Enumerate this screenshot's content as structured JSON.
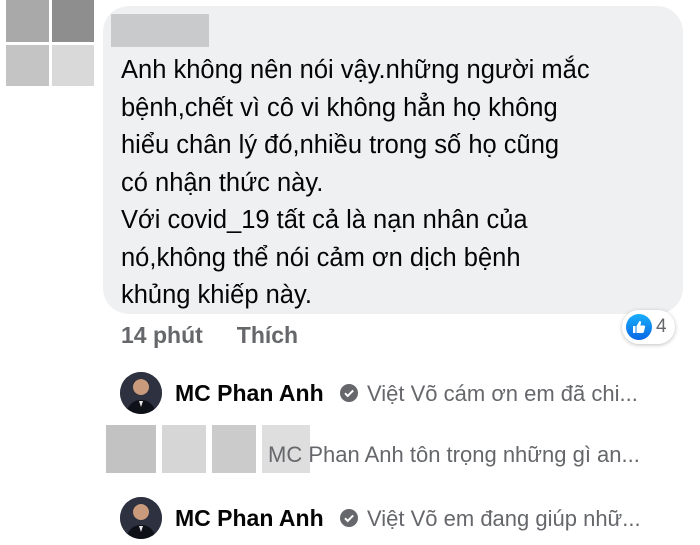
{
  "comment": {
    "text": "Anh không nên nói vậy.những người mắc\nbệnh,chết vì cô vi không hẳn họ không\nhiểu chân lý đó,nhiều trong số họ cũng\ncó nhận thức này.\n Với covid_19 tất cả là nạn nhân của\nnó,không thể nói cảm ơn dịch bệnh\nkhủng khiếp này.",
    "time": "14 phút",
    "like_label": "Thích",
    "reaction_count": "4"
  },
  "replies": [
    {
      "author": "MC Phan Anh",
      "text": "Việt Võ cám ơn em đã chi..."
    },
    {
      "author": "",
      "text": "MC Phan Anh tôn trọng những gì an..."
    },
    {
      "author": "MC Phan Anh",
      "text": "Việt Võ em đang giúp nhữ..."
    }
  ],
  "colors": {
    "bubble": "#eef0f2",
    "accent": "#1877f2",
    "meta_text": "#65676b"
  }
}
